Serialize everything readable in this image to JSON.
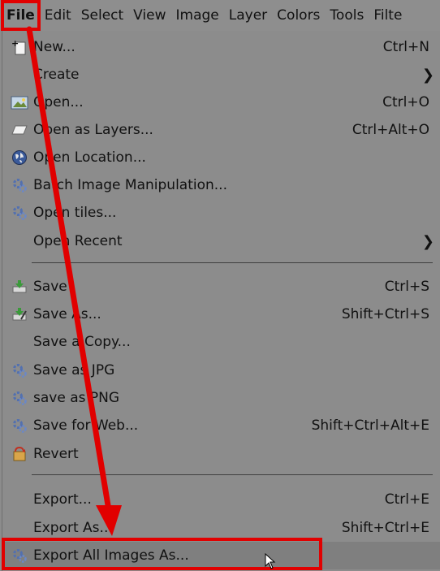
{
  "menubar": {
    "items": [
      "File",
      "Edit",
      "Select",
      "View",
      "Image",
      "Layer",
      "Colors",
      "Tools",
      "Filte"
    ]
  },
  "file_menu": {
    "items": [
      {
        "label": "New...",
        "shortcut": "Ctrl+N",
        "icon": "new-icon"
      },
      {
        "label": "Create",
        "submenu": true,
        "icon": ""
      },
      {
        "label": "Open...",
        "shortcut": "Ctrl+O",
        "icon": "open-icon"
      },
      {
        "label": "Open as Layers...",
        "shortcut": "Ctrl+Alt+O",
        "icon": "open-layers-icon"
      },
      {
        "label": "Open Location...",
        "icon": "globe-icon"
      },
      {
        "label": "Batch Image Manipulation...",
        "icon": "gear-script-icon"
      },
      {
        "label": "Open tiles...",
        "icon": "gear-script-icon"
      },
      {
        "label": "Open Recent",
        "submenu": true,
        "icon": ""
      },
      {
        "label": "Save",
        "shortcut": "Ctrl+S",
        "icon": "save-icon"
      },
      {
        "label": "Save As...",
        "shortcut": "Shift+Ctrl+S",
        "icon": "save-as-icon"
      },
      {
        "label": "Save a Copy...",
        "icon": ""
      },
      {
        "label": "Save as JPG",
        "icon": "gear-script-icon"
      },
      {
        "label": "save as PNG",
        "icon": "gear-script-icon"
      },
      {
        "label": "Save for Web...",
        "shortcut": "Shift+Ctrl+Alt+E",
        "icon": "gear-script-icon"
      },
      {
        "label": "Revert",
        "icon": "revert-icon"
      },
      {
        "label": "Export...",
        "shortcut": "Ctrl+E",
        "icon": ""
      },
      {
        "label": "Export As...",
        "shortcut": "Shift+Ctrl+E",
        "icon": ""
      },
      {
        "label": "Export All Images As...",
        "icon": "gear-script-icon"
      }
    ]
  },
  "annotation": {
    "color": "#e10000"
  }
}
